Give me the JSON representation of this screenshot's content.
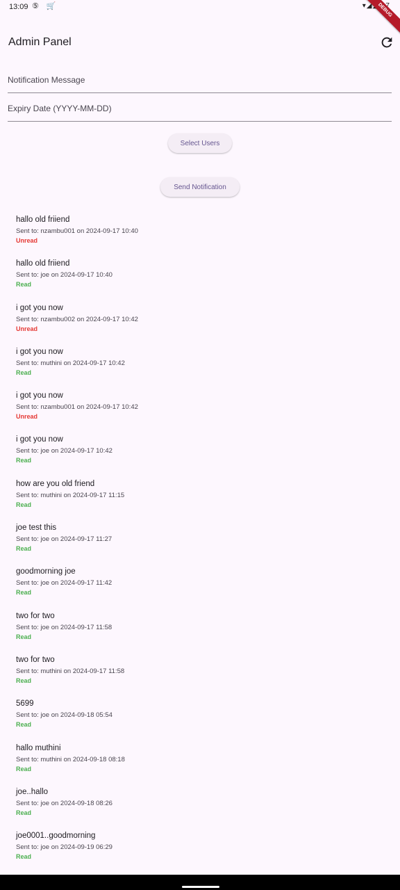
{
  "status_bar": {
    "time": "13:09",
    "notif_icons": "⑤ 🛒",
    "right_icons": "▾◢◢ ▮7"
  },
  "debug_banner": "DEBUG",
  "app_bar": {
    "title": "Admin Panel",
    "refresh_icon": "refresh-icon"
  },
  "form": {
    "message_placeholder": "Notification Message",
    "expiry_placeholder": "Expiry Date (YYYY-MM-DD)",
    "select_users_label": "Select Users",
    "send_label": "Send Notification"
  },
  "colors": {
    "background": "#fdf7fe",
    "read": "#4caf50",
    "unread": "#e53935",
    "button_text": "#65558f"
  },
  "notifications": [
    {
      "message": "hallo old friiend",
      "sent": "Sent to: nzambu001 on 2024-09-17 10:40",
      "status": "Unread"
    },
    {
      "message": "hallo old friiend",
      "sent": "Sent to: joe on 2024-09-17 10:40",
      "status": "Read"
    },
    {
      "message": "i got you now",
      "sent": "Sent to: nzambu002 on 2024-09-17 10:42",
      "status": "Unread"
    },
    {
      "message": "i got you now",
      "sent": "Sent to: muthini on 2024-09-17 10:42",
      "status": "Read"
    },
    {
      "message": "i got you now",
      "sent": "Sent to: nzambu001 on 2024-09-17 10:42",
      "status": "Unread"
    },
    {
      "message": "i got you now",
      "sent": "Sent to: joe on 2024-09-17 10:42",
      "status": "Read"
    },
    {
      "message": "how are you old friend",
      "sent": "Sent to: muthini on 2024-09-17 11:15",
      "status": "Read"
    },
    {
      "message": "joe test this",
      "sent": "Sent to: joe on 2024-09-17 11:27",
      "status": "Read"
    },
    {
      "message": "goodmorning joe",
      "sent": "Sent to: joe on 2024-09-17 11:42",
      "status": "Read"
    },
    {
      "message": "two for two",
      "sent": "Sent to: joe on 2024-09-17 11:58",
      "status": "Read"
    },
    {
      "message": "two for two",
      "sent": "Sent to: muthini on 2024-09-17 11:58",
      "status": "Read"
    },
    {
      "message": "5699",
      "sent": "Sent to: joe on 2024-09-18 05:54",
      "status": "Read"
    },
    {
      "message": "hallo muthini",
      "sent": "Sent to: muthini on 2024-09-18 08:18",
      "status": "Read"
    },
    {
      "message": "joe..hallo",
      "sent": "Sent to: joe on 2024-09-18 08:26",
      "status": "Read"
    },
    {
      "message": "joe0001..goodmorning",
      "sent": "Sent to: joe on 2024-09-19 06:29",
      "status": "Read"
    }
  ]
}
